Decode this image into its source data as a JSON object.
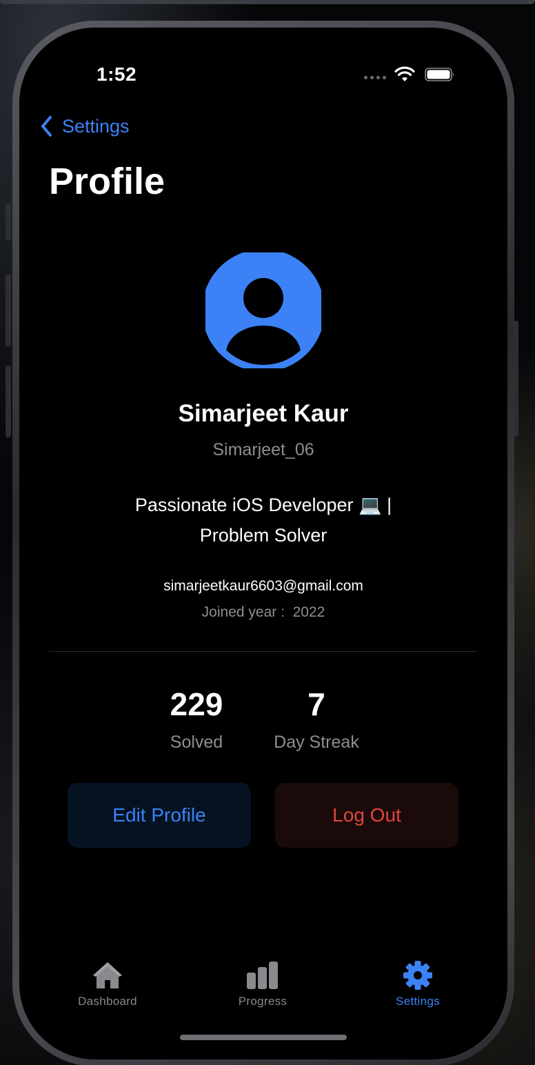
{
  "status_bar": {
    "time": "1:52"
  },
  "nav": {
    "back_label": "Settings",
    "title": "Profile"
  },
  "profile": {
    "name": "Simarjeet Kaur",
    "username": "Simarjeet_06",
    "bio": "Passionate iOS Developer 💻 | Problem Solver",
    "email": "simarjeetkaur6603@gmail.com",
    "joined_label": "Joined year :",
    "joined_year": "2022"
  },
  "stats": [
    {
      "value": "229",
      "label": "Solved"
    },
    {
      "value": "7",
      "label": "Day Streak"
    }
  ],
  "actions": {
    "edit_label": "Edit Profile",
    "logout_label": "Log Out"
  },
  "tabbar": [
    {
      "label": "Dashboard",
      "icon": "house-icon",
      "active": false
    },
    {
      "label": "Progress",
      "icon": "bar-chart-icon",
      "active": false
    },
    {
      "label": "Settings",
      "icon": "gear-icon",
      "active": true
    }
  ],
  "colors": {
    "accent": "#3c82f6",
    "destructive": "#e0443c",
    "background": "#000000",
    "secondary_text": "#8e8e93"
  }
}
